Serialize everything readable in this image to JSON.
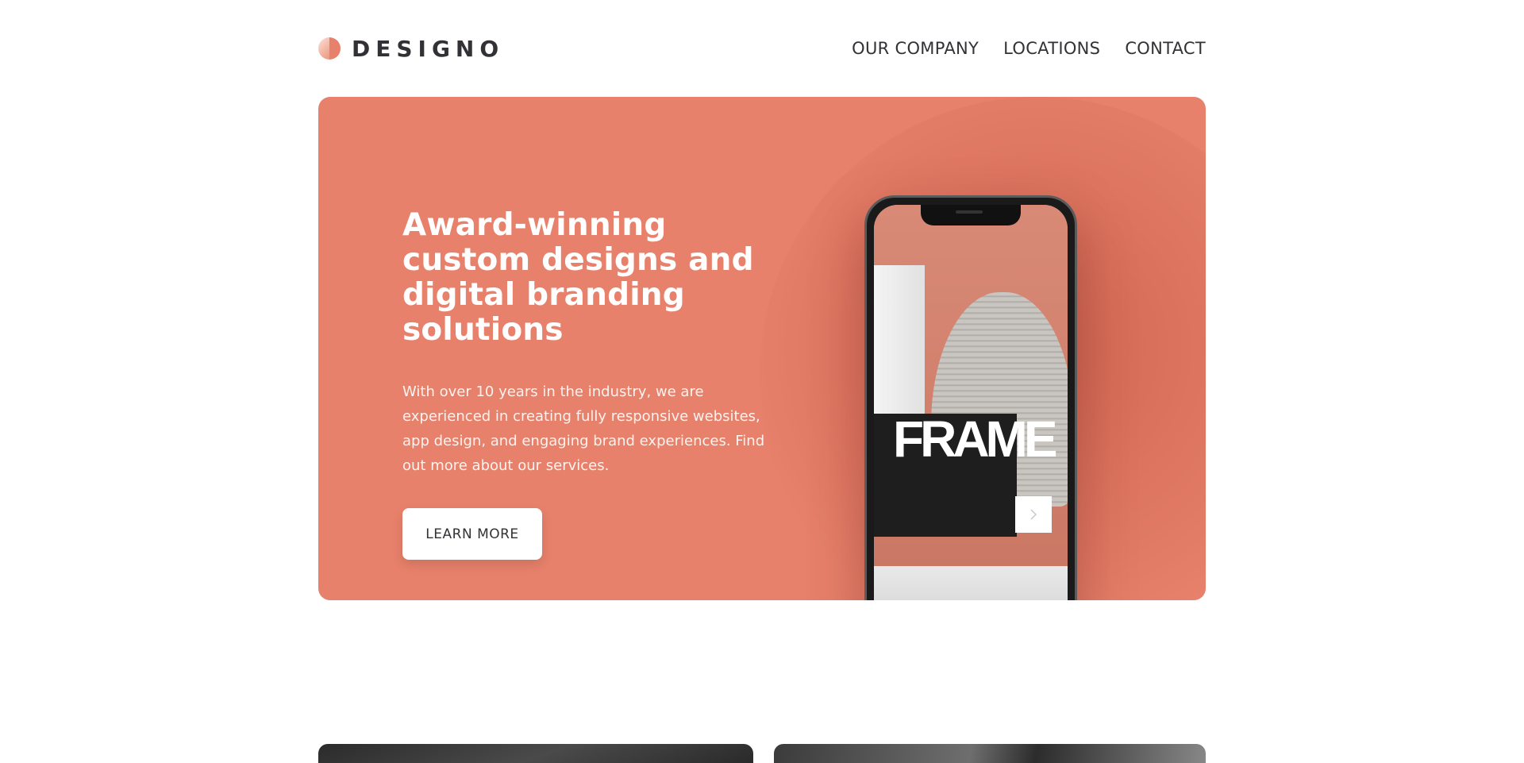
{
  "header": {
    "logo_text": "DESIGNO",
    "nav": [
      {
        "label": "OUR COMPANY"
      },
      {
        "label": "LOCATIONS"
      },
      {
        "label": "CONTACT"
      }
    ]
  },
  "hero": {
    "title": "Award-winning custom designs and digital branding solutions",
    "description": "With over 10 years in the industry, we are experienced in creating fully responsive websites, app design, and engaging brand experiences. Find out more about our services.",
    "button_label": "LEARN MORE",
    "phone_screen_text": "FRAME"
  },
  "colors": {
    "accent": "#e7816b",
    "text_dark": "#333136",
    "white": "#ffffff"
  },
  "icons": {
    "logo": "designo-logo-icon",
    "next": "chevron-right-icon"
  }
}
